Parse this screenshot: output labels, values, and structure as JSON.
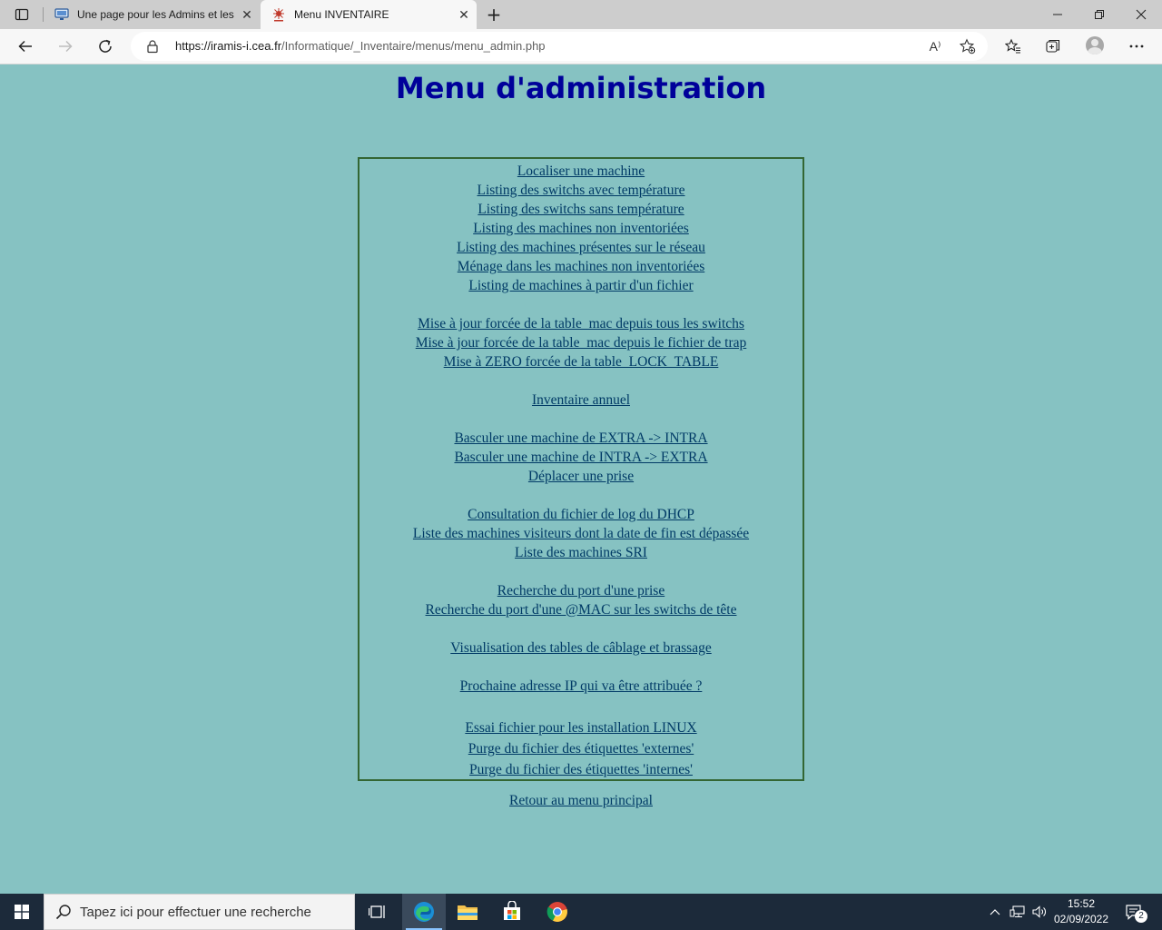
{
  "browser": {
    "tabs": [
      {
        "title": "Une page pour les Admins et les",
        "active": false,
        "favicon": "monitor-icon"
      },
      {
        "title": "Menu INVENTAIRE",
        "active": true,
        "favicon": "iramis-logo-icon"
      }
    ],
    "new_tab_glyph": "+",
    "url_host": "https://iramis-i.cea.fr",
    "url_path": "/Informatique/_Inventaire/menus/menu_admin.php",
    "read_aloud_label": "A⁾"
  },
  "page": {
    "title": "Menu d'administration",
    "menu_groups": [
      [
        "Localiser une machine",
        "Listing des switchs avec température",
        "Listing des switchs sans température",
        "Listing des machines non inventoriées",
        "Listing des machines présentes sur le réseau",
        "Ménage dans les machines non inventoriées",
        "Listing de machines à partir d'un fichier"
      ],
      [
        "Mise à jour forcée de la table_mac depuis tous les switchs",
        "Mise à jour forcée de la table_mac depuis le fichier de trap",
        "Mise à ZERO forcée de la table_LOCK_TABLE"
      ],
      [
        "Inventaire annuel"
      ],
      [
        "Basculer une machine de EXTRA -> INTRA",
        "Basculer une machine de INTRA -> EXTRA",
        "Déplacer une prise"
      ],
      [
        "Consultation du fichier de log du DHCP",
        "Liste des machines visiteurs dont la date de fin est dépassée",
        "Liste des machines SRI"
      ],
      [
        "Recherche du port d'une prise",
        "Recherche du port d'une @MAC sur les switchs de tête"
      ],
      [
        "Visualisation des tables de câblage et brassage"
      ],
      [
        "Prochaine adresse IP qui va être attribuée ?"
      ],
      [
        "Essai fichier pour les installation LINUX",
        "Purge du fichier des étiquettes 'externes'",
        "Purge du fichier des étiquettes 'internes'"
      ]
    ],
    "back_link": "Retour au menu principal"
  },
  "taskbar": {
    "search_placeholder": "Tapez ici pour effectuer une recherche",
    "time": "15:52",
    "date": "02/09/2022",
    "notification_count": "2",
    "apps": [
      "task-view-icon",
      "edge-icon",
      "file-explorer-icon",
      "store-icon",
      "chrome-icon"
    ]
  },
  "colors": {
    "page_background": "#86c2c2",
    "title": "#00009a",
    "link": "#003a66",
    "menu_border": "#336633",
    "taskbar": "#1c2a3a"
  }
}
